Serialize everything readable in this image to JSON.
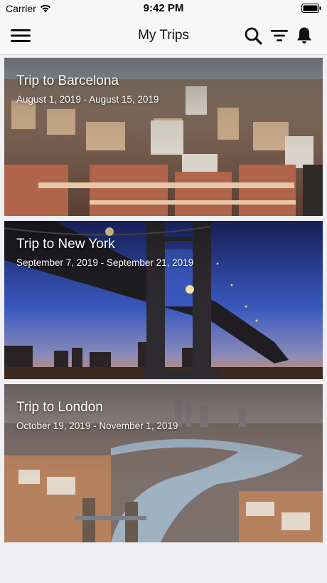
{
  "status_bar": {
    "carrier": "Carrier",
    "time": "9:42 PM"
  },
  "nav": {
    "title": "My Trips",
    "icons": [
      "menu-icon",
      "search-icon",
      "filter-icon",
      "bell-icon"
    ]
  },
  "trips": [
    {
      "title": "Trip to Barcelona",
      "dates": "August 1, 2019 - August 15, 2019"
    },
    {
      "title": "Trip to New York",
      "dates": "September 7, 2019 - September 21, 2019"
    },
    {
      "title": "Trip to London",
      "dates": "October 19, 2019 - November 1, 2019"
    }
  ],
  "colors": {
    "background": "#efeff4",
    "bar": "#f7f7f7"
  }
}
